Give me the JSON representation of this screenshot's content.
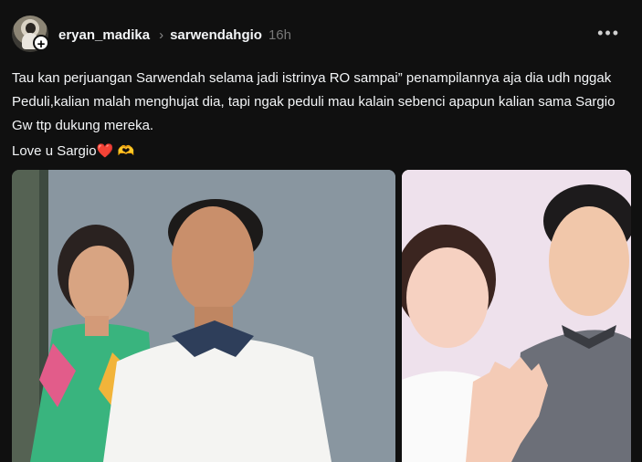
{
  "post": {
    "username": "eryan_madika",
    "reply_to": "sarwendahgio",
    "time": "16h",
    "more_icon": "more-dots-icon",
    "text": "Tau kan perjuangan Sarwendah selama jadi istrinya RO sampai” penampilannya aja dia udh nggak Peduli,kalian malah menghujat dia, tapi ngak peduli mau kalain sebenci apapun kalian sama Sargio Gw ttp dukung mereka.",
    "love_text": "Love u Sargio",
    "heart_emoji": "❤️",
    "hands_emoji": "🫶"
  },
  "images": [
    {
      "name": "photo-couple-outdoor"
    },
    {
      "name": "photo-couple-selfie"
    }
  ],
  "colors": {
    "background": "#101010",
    "text": "#f3f5f7",
    "muted": "#777777"
  }
}
